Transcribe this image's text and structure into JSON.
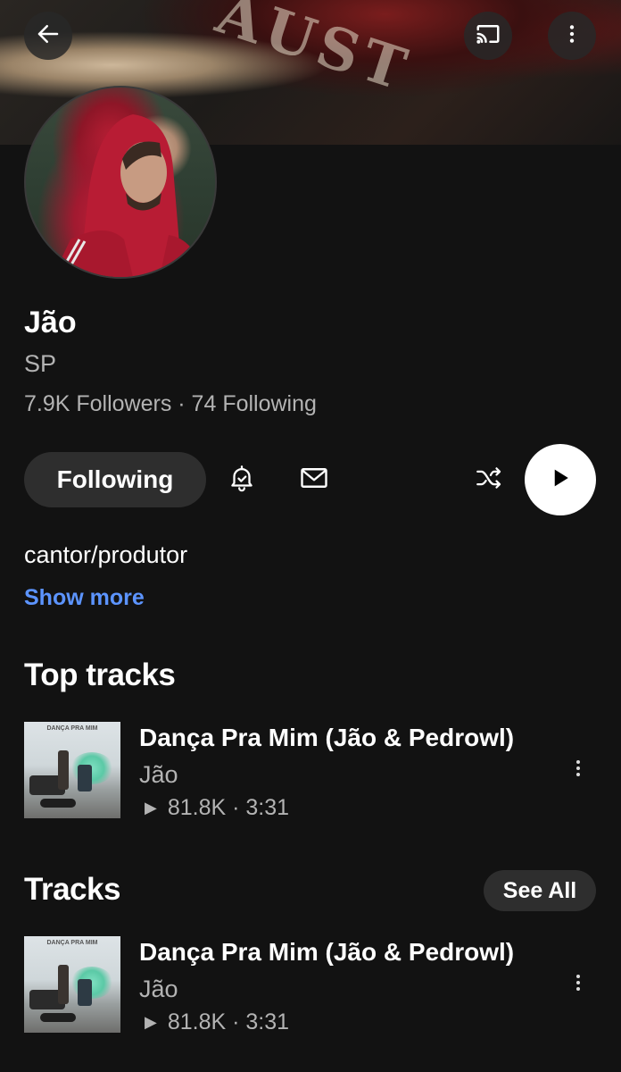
{
  "header": {
    "banner_text": "AUST",
    "back_icon": "arrow-left-icon",
    "cast_icon": "cast-icon",
    "more_icon": "more-vertical-icon"
  },
  "profile": {
    "name": "Jão",
    "location": "SP",
    "stats": "7.9K Followers · 74 Following",
    "following_label": "Following",
    "bio": "cantor/produtor",
    "show_more_label": "Show more"
  },
  "actions": {
    "bell_icon": "bell-check-icon",
    "mail_icon": "mail-icon",
    "shuffle_icon": "shuffle-icon",
    "play_icon": "play-icon"
  },
  "sections": {
    "top_tracks_title": "Top tracks",
    "tracks_title": "Tracks",
    "see_all_label": "See All"
  },
  "top_tracks": [
    {
      "title": "Dança Pra Mim (Jão & Pedrowl)",
      "artist": "Jão",
      "plays": "81.8K",
      "duration": "3:31",
      "meta": "81.8K · 3:31",
      "cover_text": "DANÇA PRA MIM"
    }
  ],
  "tracks": [
    {
      "title": "Dança Pra Mim (Jão & Pedrowl)",
      "artist": "Jão",
      "plays": "81.8K",
      "duration": "3:31",
      "meta": "81.8K · 3:31",
      "cover_text": "DANÇA PRA MIM"
    }
  ],
  "colors": {
    "background": "#121212",
    "link": "#5c94ff",
    "secondary_text": "#b3b3b3",
    "pill": "#2e2e2e"
  }
}
